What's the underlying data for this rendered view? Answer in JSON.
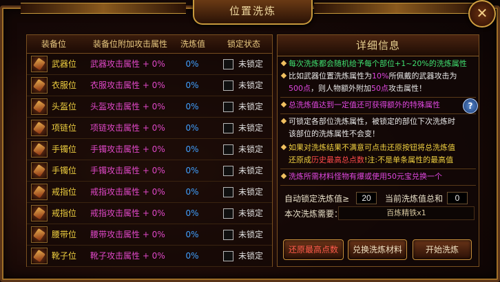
{
  "window": {
    "title": "位置洗炼",
    "close_icon": "✕"
  },
  "table": {
    "headers": {
      "slot": "装备位",
      "attr": "装备位附加攻击属性",
      "value": "洗炼值",
      "lock": "锁定状态"
    },
    "rows": [
      {
        "icon": "weapon-icon",
        "slot": "武器位",
        "attr": "武器攻击属性 + 0%",
        "value": "0%",
        "lock": "未锁定"
      },
      {
        "icon": "armor-icon",
        "slot": "衣服位",
        "attr": "衣服攻击属性 + 0%",
        "value": "0%",
        "lock": "未锁定"
      },
      {
        "icon": "helmet-icon",
        "slot": "头盔位",
        "attr": "头盔攻击属性 + 0%",
        "value": "0%",
        "lock": "未锁定"
      },
      {
        "icon": "necklace-icon",
        "slot": "项链位",
        "attr": "项链攻击属性 + 0%",
        "value": "0%",
        "lock": "未锁定"
      },
      {
        "icon": "bracelet-icon",
        "slot": "手镯位",
        "attr": "手镯攻击属性 + 0%",
        "value": "0%",
        "lock": "未锁定"
      },
      {
        "icon": "bracelet-icon",
        "slot": "手镯位",
        "attr": "手镯攻击属性 + 0%",
        "value": "0%",
        "lock": "未锁定"
      },
      {
        "icon": "ring-icon",
        "slot": "戒指位",
        "attr": "戒指攻击属性 + 0%",
        "value": "0%",
        "lock": "未锁定"
      },
      {
        "icon": "ring-icon",
        "slot": "戒指位",
        "attr": "戒指攻击属性 + 0%",
        "value": "0%",
        "lock": "未锁定"
      },
      {
        "icon": "belt-icon",
        "slot": "腰带位",
        "attr": "腰带攻击属性 + 0%",
        "value": "0%",
        "lock": "未锁定"
      },
      {
        "icon": "boots-icon",
        "slot": "靴子位",
        "attr": "靴子攻击属性 + 0%",
        "value": "0%",
        "lock": "未锁定"
      }
    ]
  },
  "detail": {
    "title": "详细信息",
    "line1": "每次洗炼都会随机给予每个部位+1~20%的洗炼属性",
    "line2a": "比如武器位置洗炼属性为",
    "line2b": "10%",
    "line2c": "所佩戴的武器攻击为",
    "line3a": "500点",
    "line3b": "，则人物额外附加",
    "line3c": "50点",
    "line3d": "攻击属性！",
    "line4": "总洗炼值达到一定值还可获得额外的特殊属性",
    "help_icon": "?",
    "line5a": "可锁定各部位洗炼属性，被锁定的部位下次洗炼时",
    "line5b": "该部位的洗炼属性不会变！",
    "line6a": "如果对洗炼结果不满意可点击还原按钮将总洗炼值",
    "line6b1": "还原成",
    "line6b2": "历史最高总点数",
    "line6b3": "!注:不是单条属性的最高值",
    "line7": "洗炼所需材料怪物有爆或使用50元宝兑换一个"
  },
  "controls": {
    "auto_stop_label": "自动锁定洗炼值≥",
    "auto_stop_value": "20",
    "current_total_label": "当前洗炼值总和",
    "current_total_value": "0",
    "material_label": "本次洗炼需要：",
    "material_value": "百炼精铁x1"
  },
  "buttons": {
    "restore": "还原最高点数",
    "exchange": "兑换洗炼材料",
    "start": "开始洗炼"
  }
}
